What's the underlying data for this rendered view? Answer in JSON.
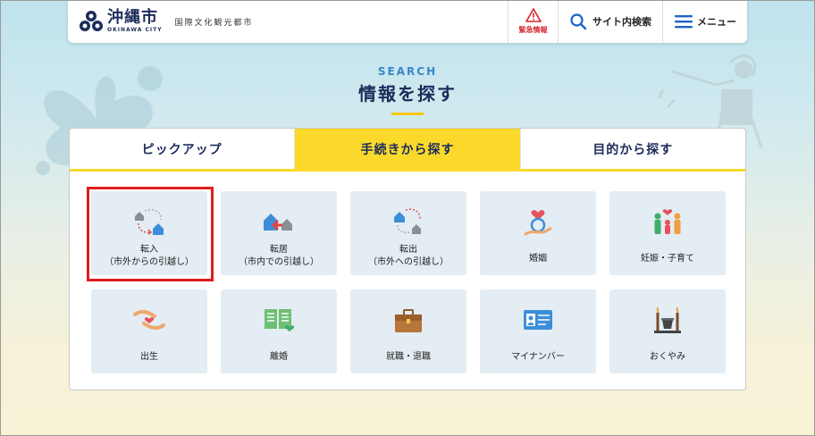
{
  "header": {
    "logo_name": "沖縄市",
    "logo_roman": "OKINAWA CITY",
    "tagline": "国際文化観光都市",
    "emergency_label": "緊急情報",
    "search_label": "サイト内検索",
    "menu_label": "メニュー"
  },
  "section": {
    "subtitle": "SEARCH",
    "title": "情報を探す"
  },
  "tabs": [
    {
      "label": "ピックアップ",
      "active": false
    },
    {
      "label": "手続きから探す",
      "active": true
    },
    {
      "label": "目的から探す",
      "active": false
    }
  ],
  "tiles": [
    {
      "label": "転入\n（市外からの引越し）",
      "icon": "move-in-icon",
      "highlighted": true
    },
    {
      "label": "転居\n（市内での引越し）",
      "icon": "move-within-icon"
    },
    {
      "label": "転出\n（市外への引越し）",
      "icon": "move-out-icon"
    },
    {
      "label": "婚姻",
      "icon": "ring-icon"
    },
    {
      "label": "妊娠・子育て",
      "icon": "family-icon"
    },
    {
      "label": "出生",
      "icon": "baby-hands-icon"
    },
    {
      "label": "離婚",
      "icon": "documents-icon"
    },
    {
      "label": "就職・退職",
      "icon": "briefcase-icon"
    },
    {
      "label": "マイナンバー",
      "icon": "id-card-icon"
    },
    {
      "label": "おくやみ",
      "icon": "memorial-icon"
    }
  ],
  "colors": {
    "accent_yellow": "#fad92b",
    "navy": "#1c2b5a",
    "emergency_red": "#d4252a",
    "highlight_red": "#e11c1c",
    "tile_bg": "#e3edf3"
  }
}
